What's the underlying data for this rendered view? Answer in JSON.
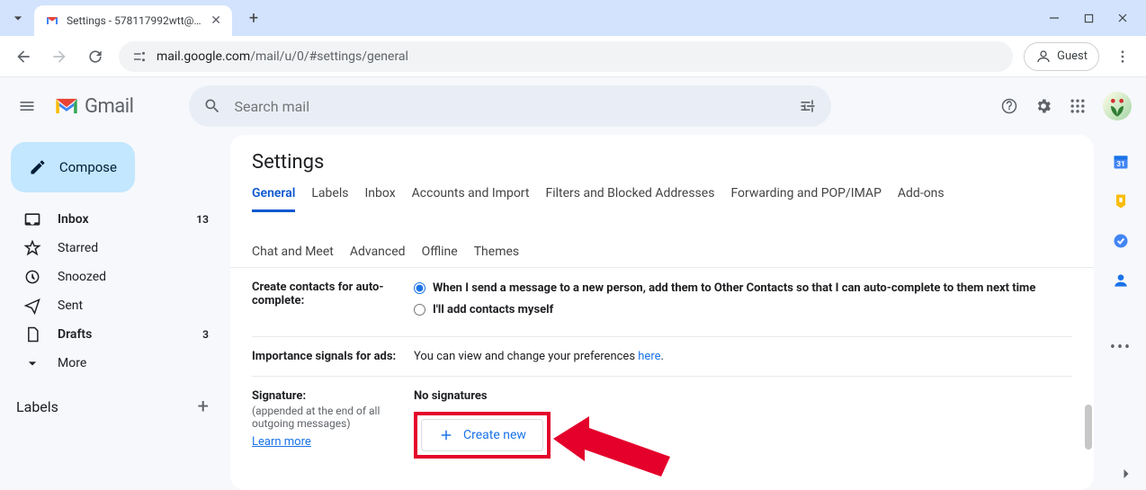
{
  "browser": {
    "tab_title": "Settings - 578117992wtt@gm",
    "url_display_host": "mail.google.com",
    "url_display_path": "/mail/u/0/#settings/general",
    "guest_label": "Guest"
  },
  "header": {
    "brand": "Gmail",
    "search_placeholder": "Search mail"
  },
  "sidebar": {
    "compose": "Compose",
    "items": [
      {
        "icon": "inbox",
        "label": "Inbox",
        "count": "13",
        "bold": true
      },
      {
        "icon": "star",
        "label": "Starred",
        "count": "",
        "bold": false
      },
      {
        "icon": "clock",
        "label": "Snoozed",
        "count": "",
        "bold": false
      },
      {
        "icon": "send",
        "label": "Sent",
        "count": "",
        "bold": false
      },
      {
        "icon": "file",
        "label": "Drafts",
        "count": "3",
        "bold": true
      },
      {
        "icon": "chevron",
        "label": "More",
        "count": "",
        "bold": false
      }
    ],
    "labels_heading": "Labels"
  },
  "settings": {
    "title": "Settings",
    "tabs_row1": [
      "General",
      "Labels",
      "Inbox",
      "Accounts and Import",
      "Filters and Blocked Addresses",
      "Forwarding and POP/IMAP",
      "Add-ons"
    ],
    "tabs_row2": [
      "Chat and Meet",
      "Advanced",
      "Offline",
      "Themes"
    ],
    "active_tab": "General",
    "contacts": {
      "label": "Create contacts for auto-complete:",
      "opt1": "When I send a message to a new person, add them to Other Contacts so that I can auto-complete to them next time",
      "opt2": "I'll add contacts myself"
    },
    "ads": {
      "label": "Importance signals for ads:",
      "text_prefix": "You can view and change your preferences ",
      "link": "here",
      "text_suffix": "."
    },
    "signature": {
      "label": "Signature:",
      "sub": "(appended at the end of all outgoing messages)",
      "learn_more": "Learn more",
      "none": "No signatures",
      "create": "Create new"
    }
  }
}
